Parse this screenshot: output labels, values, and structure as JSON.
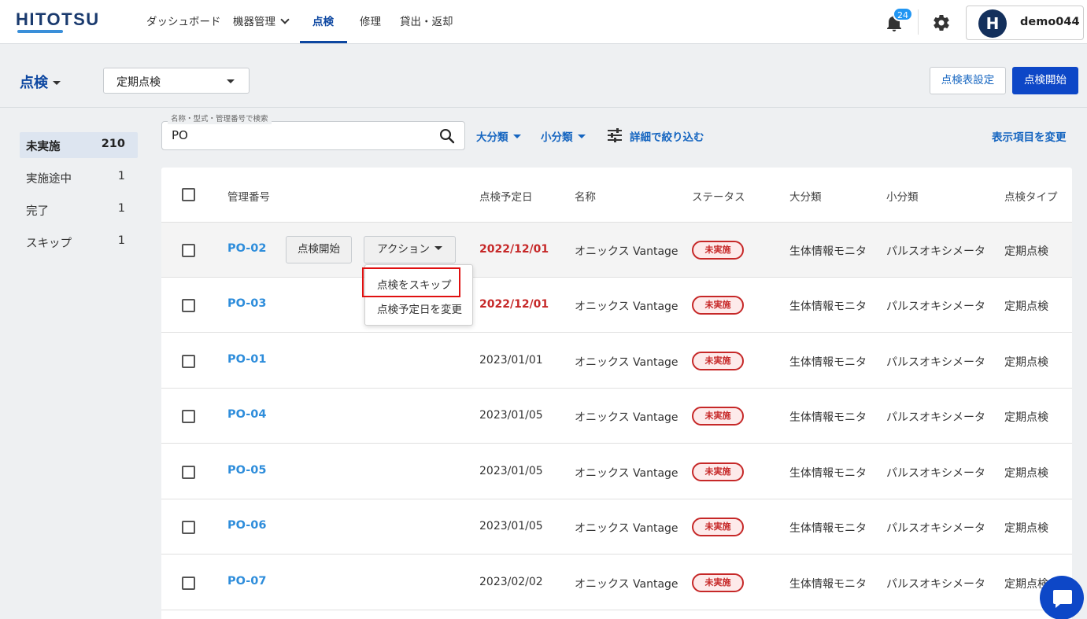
{
  "app": {
    "logo": "HITOTSU"
  },
  "nav": {
    "items": [
      {
        "label": "ダッシュボード"
      },
      {
        "label": "機器管理"
      },
      {
        "label": "点検"
      },
      {
        "label": "修理"
      },
      {
        "label": "貸出・返却"
      }
    ],
    "notification_count": "24",
    "user": {
      "initial": "H",
      "name": "demo044"
    }
  },
  "subheader": {
    "title": "点検",
    "type_select": "定期点検",
    "settings_button": "点検表設定",
    "start_button": "点検開始"
  },
  "status_list": [
    {
      "label": "未実施",
      "count": "210"
    },
    {
      "label": "実施途中",
      "count": "1"
    },
    {
      "label": "完了",
      "count": "1"
    },
    {
      "label": "スキップ",
      "count": "1"
    }
  ],
  "search": {
    "legend": "名称・型式・管理番号で検索",
    "value": "PO"
  },
  "filters": {
    "major": "大分類",
    "minor": "小分類",
    "detail": "詳細で絞り込む",
    "change_columns": "表示項目を変更"
  },
  "table": {
    "columns": [
      "管理番号",
      "点検予定日",
      "名称",
      "ステータス",
      "大分類",
      "小分類",
      "点検タイプ"
    ],
    "rows": [
      {
        "id": "PO-02",
        "date": "2022/12/01",
        "overdue": true,
        "name": "オニックス Vantage",
        "status": "未実施",
        "major": "生体情報モニタ",
        "minor": "パルスオキシメータ",
        "type": "定期点検"
      },
      {
        "id": "PO-03",
        "date": "2022/12/01",
        "overdue": true,
        "name": "オニックス Vantage",
        "status": "未実施",
        "major": "生体情報モニタ",
        "minor": "パルスオキシメータ",
        "type": "定期点検"
      },
      {
        "id": "PO-01",
        "date": "2023/01/01",
        "overdue": false,
        "name": "オニックス Vantage",
        "status": "未実施",
        "major": "生体情報モニタ",
        "minor": "パルスオキシメータ",
        "type": "定期点検"
      },
      {
        "id": "PO-04",
        "date": "2023/01/05",
        "overdue": false,
        "name": "オニックス Vantage",
        "status": "未実施",
        "major": "生体情報モニタ",
        "minor": "パルスオキシメータ",
        "type": "定期点検"
      },
      {
        "id": "PO-05",
        "date": "2023/01/05",
        "overdue": false,
        "name": "オニックス Vantage",
        "status": "未実施",
        "major": "生体情報モニタ",
        "minor": "パルスオキシメータ",
        "type": "定期点検"
      },
      {
        "id": "PO-06",
        "date": "2023/01/05",
        "overdue": false,
        "name": "オニックス Vantage",
        "status": "未実施",
        "major": "生体情報モニタ",
        "minor": "パルスオキシメータ",
        "type": "定期点検"
      },
      {
        "id": "PO-07",
        "date": "2023/02/02",
        "overdue": false,
        "name": "オニックス Vantage",
        "status": "未実施",
        "major": "生体情報モニタ",
        "minor": "パルスオキシメータ",
        "type": "定期点検"
      }
    ],
    "row_start_button": "点検開始",
    "row_action_button": "アクション"
  },
  "action_menu": {
    "items": [
      "点検をスキップ",
      "点検予定日を変更"
    ]
  },
  "colors": {
    "primary": "#0d47c7",
    "link": "#2e8ddb",
    "overdue": "#c62828",
    "highlight": "#e01010"
  }
}
